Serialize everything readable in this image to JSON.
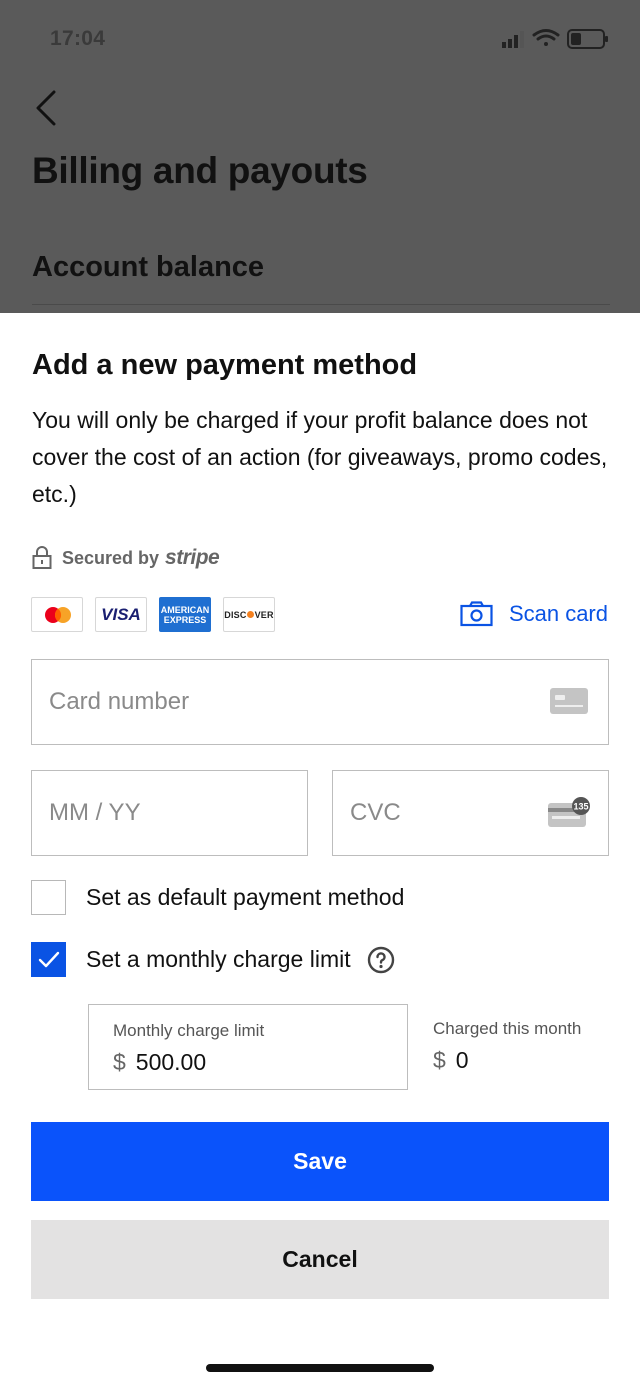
{
  "status_bar": {
    "time": "17:04"
  },
  "page": {
    "title": "Billing and payouts",
    "section_title": "Account balance"
  },
  "sheet": {
    "title": "Add a new payment method",
    "description": "You will only be charged if your profit balance does not cover the cost of an action (for giveaways, promo codes, etc.)",
    "secured_label": "Secured by",
    "secured_brand": "stripe",
    "card_brands": {
      "visa": "VISA",
      "amex_line1": "AMERICAN",
      "amex_line2": "EXPRESS",
      "discover_pre": "DISC",
      "discover_post": "VER"
    },
    "scan_card_label": "Scan card",
    "card_number_placeholder": "Card number",
    "expiry_placeholder": "MM / YY",
    "cvc_placeholder": "CVC",
    "cvc_icon_text": "135",
    "default_label": "Set as default payment method",
    "default_checked": false,
    "limit_label": "Set a monthly charge limit",
    "limit_checked": true,
    "monthly_limit_caption": "Monthly charge limit",
    "currency_symbol": "$",
    "monthly_limit_value": "500.00",
    "charged_caption": "Charged this month",
    "charged_value": "0",
    "save_label": "Save",
    "cancel_label": "Cancel"
  },
  "colors": {
    "accent": "#0a53fb",
    "link": "#0a53e4",
    "overlay": "#5a5a5a",
    "cancel_bg": "#e3e2e2"
  }
}
